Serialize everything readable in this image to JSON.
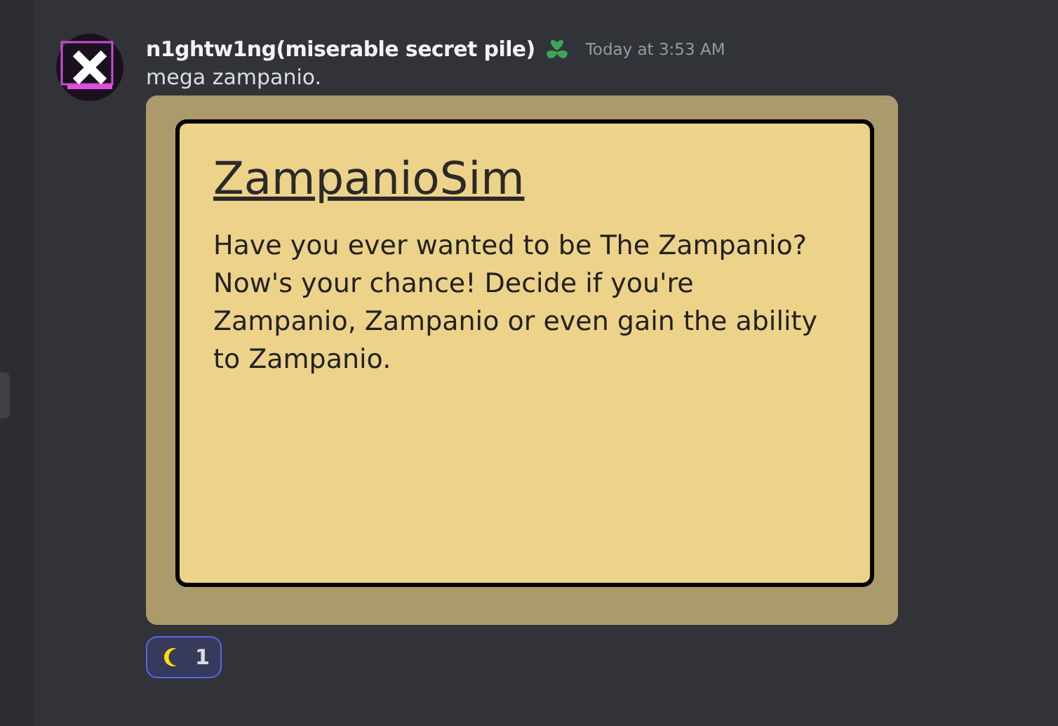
{
  "message": {
    "author": "n1ghtw1ng(miserable secret pile)",
    "timestamp": "Today at 3:53 AM",
    "text": "mega zampanio."
  },
  "embed": {
    "title": "ZampanioSim",
    "description": "Have you ever wanted to be The Zampanio? Now's your chance! Decide if you're Zampanio, Zampanio or even gain the ability to Zampanio."
  },
  "reactions": [
    {
      "count": "1",
      "selected": true
    }
  ]
}
